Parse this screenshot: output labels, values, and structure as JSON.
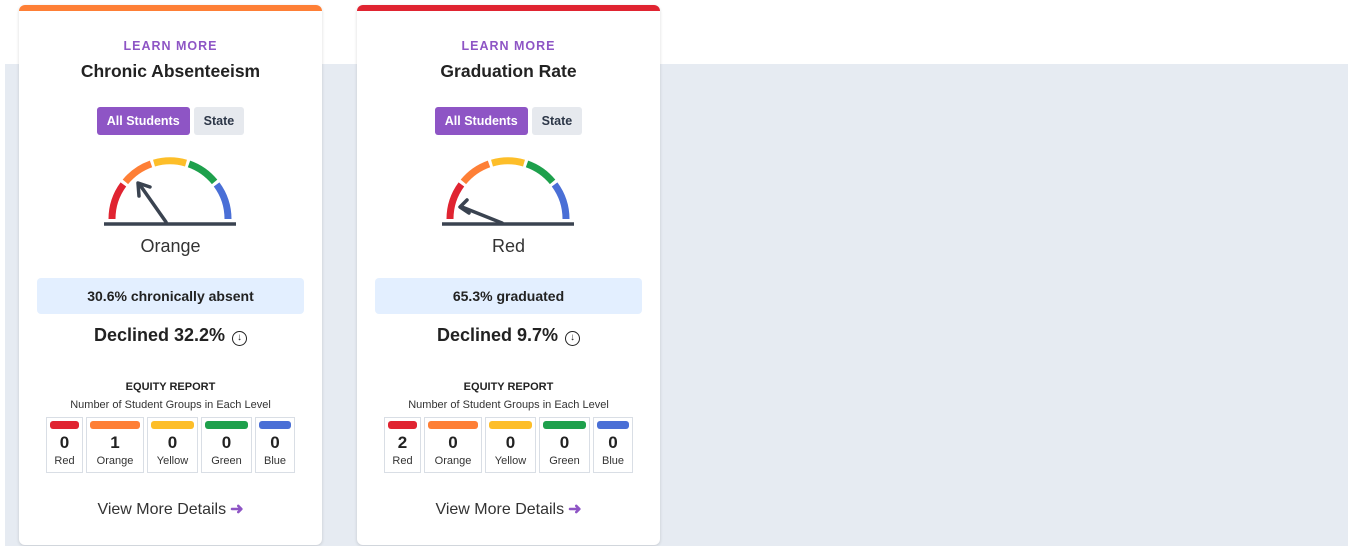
{
  "colors": {
    "red": "#e02431",
    "orange": "#fe7f36",
    "yellow": "#fdbe29",
    "green": "#1ea04c",
    "blue": "#4a6fd6",
    "accent": "#8e55c5",
    "bar1": "#fe7f36",
    "bar2": "#e02431"
  },
  "cards": [
    {
      "learn_more": "LEARN MORE",
      "title": "Chronic Absenteeism",
      "toggle_all": "All Students",
      "toggle_state": "State",
      "gauge_level_index": 1,
      "level": "Orange",
      "stat": "30.6% chronically absent",
      "change": "Declined 32.2%",
      "change_icon": "arrow-down-circle-icon",
      "equity_title": "EQUITY REPORT",
      "equity_sub": "Number of Student Groups in Each Level",
      "counts": [
        {
          "num": "0",
          "label": "Red"
        },
        {
          "num": "1",
          "label": "Orange"
        },
        {
          "num": "0",
          "label": "Yellow"
        },
        {
          "num": "0",
          "label": "Green"
        },
        {
          "num": "0",
          "label": "Blue"
        }
      ],
      "view_more": "View More Details"
    },
    {
      "learn_more": "LEARN MORE",
      "title": "Graduation Rate",
      "toggle_all": "All Students",
      "toggle_state": "State",
      "gauge_level_index": 0,
      "level": "Red",
      "stat": "65.3% graduated",
      "change": "Declined 9.7%",
      "change_icon": "arrow-down-circle-icon",
      "equity_title": "EQUITY REPORT",
      "equity_sub": "Number of Student Groups in Each Level",
      "counts": [
        {
          "num": "2",
          "label": "Red"
        },
        {
          "num": "0",
          "label": "Orange"
        },
        {
          "num": "0",
          "label": "Yellow"
        },
        {
          "num": "0",
          "label": "Green"
        },
        {
          "num": "0",
          "label": "Blue"
        }
      ],
      "view_more": "View More Details"
    }
  ]
}
